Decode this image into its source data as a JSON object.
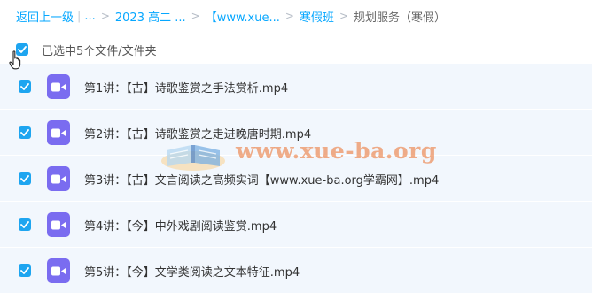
{
  "breadcrumb": {
    "back_label": "返回上一级",
    "ellipsis": "...",
    "items": [
      {
        "label": "2023 高二 ..."
      },
      {
        "label": "【www.xue..."
      },
      {
        "label": "寒假班"
      }
    ],
    "current": "规划服务（寒假）"
  },
  "selection": {
    "status_text": "已选中5个文件/文件夹",
    "checked": true
  },
  "files": [
    {
      "name": "第1讲：【古】诗歌鉴赏之手法赏析.mp4",
      "checked": true,
      "type_icon": "video-file-icon"
    },
    {
      "name": "第2讲：【古】诗歌鉴赏之走进晚唐时期.mp4",
      "checked": true,
      "type_icon": "video-file-icon"
    },
    {
      "name": "第3讲：【古】文言阅读之高频实词【www.xue-ba.org学霸网】.mp4",
      "checked": true,
      "type_icon": "video-file-icon"
    },
    {
      "name": "第4讲：【今】中外戏剧阅读鉴赏.mp4",
      "checked": true,
      "type_icon": "video-file-icon"
    },
    {
      "name": "第5讲：【今】文学类阅读之文本特征.mp4",
      "checked": true,
      "type_icon": "video-file-icon"
    }
  ],
  "watermark": {
    "text": "www.xue-ba.org"
  },
  "colors": {
    "accent": "#06a7ff",
    "checkbox": "#1ea5f0",
    "row_background": "#f2f7fd",
    "video_icon": "#7a6cf0",
    "watermark": "#eb6e28"
  }
}
